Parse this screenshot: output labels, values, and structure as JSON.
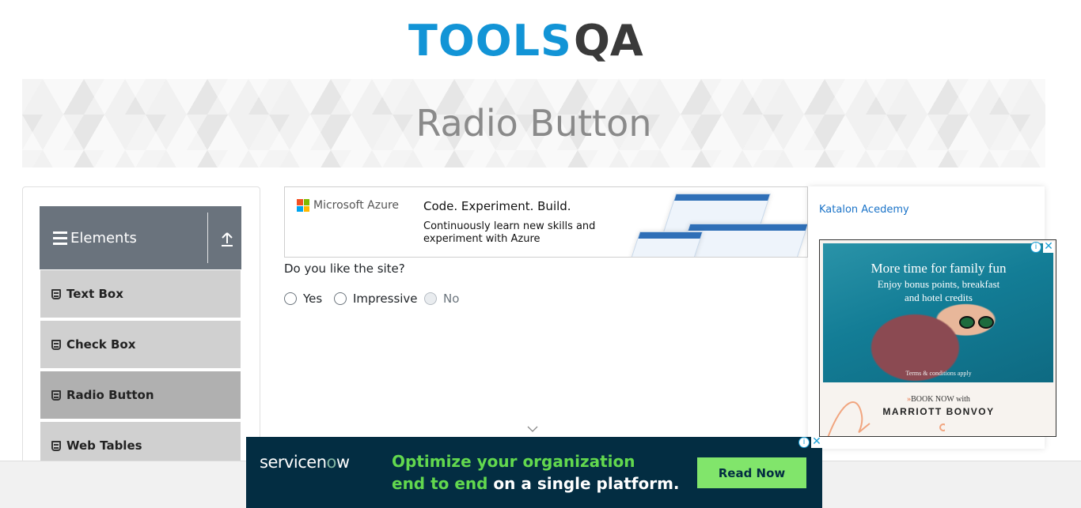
{
  "header": {
    "logo_tools": "TOOLS",
    "logo_qa": "QA",
    "banner_title": "Radio Button"
  },
  "sidebar": {
    "group_title": "Elements",
    "items": [
      {
        "label": "Text Box",
        "active": false
      },
      {
        "label": "Check Box",
        "active": false
      },
      {
        "label": "Radio Button",
        "active": true
      },
      {
        "label": "Web Tables",
        "active": false
      }
    ]
  },
  "azure_ad": {
    "brand": "Microsoft Azure",
    "headline": "Code. Experiment. Build.",
    "body": "Continuously learn new skills and experiment with Azure"
  },
  "main": {
    "question": "Do you like the site?",
    "options": [
      {
        "label": "Yes",
        "disabled": false
      },
      {
        "label": "Impressive",
        "disabled": false
      },
      {
        "label": "No",
        "disabled": true
      }
    ]
  },
  "right": {
    "link": "Katalon Acedemy"
  },
  "marriott_ad": {
    "headline": "More time for family fun",
    "sub1": "Enjoy bonus points, breakfast",
    "sub2": "and hotel credits",
    "terms": "Terms & conditions apply",
    "book_arrow": "»",
    "book": "BOOK NOW with",
    "brand": "MARRIOTT BONVOY",
    "info_icon": "i",
    "close_icon": "✕"
  },
  "servicenow_ad": {
    "logo_a": "servicen",
    "logo_b": "o",
    "logo_c": "w",
    "line1": "Optimize your organization",
    "line2_highlight": "end to end",
    "line2_rest": " on a single platform.",
    "cta": "Read Now",
    "info_icon": "i",
    "close_icon": "✕"
  },
  "colors": {
    "brand_blue": "#1294d6",
    "sidebar_header": "#6a737d",
    "menu_item": "#d0d0d0",
    "menu_active": "#b0b0b0",
    "servicenow_bg": "#032d42",
    "servicenow_green": "#62d84e"
  }
}
